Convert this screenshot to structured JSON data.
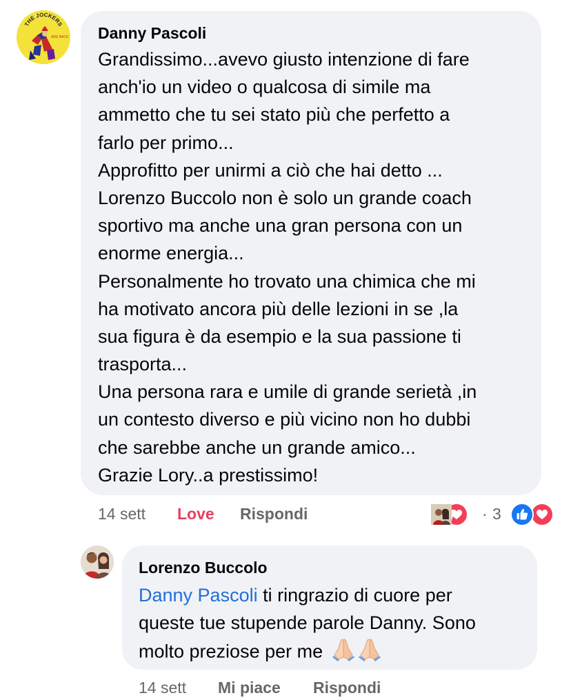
{
  "comment": {
    "author": "Danny Pascoli",
    "lines": [
      "Grandissimo...avevo giusto intenzione di fare",
      "anch'io un video o qualcosa di simile ma",
      "ammetto che tu sei stato più che perfetto a",
      "farlo per primo...",
      "Approfitto per unirmi a ciò che hai detto ...",
      "Lorenzo Buccolo non è solo un grande coach",
      "sportivo ma anche una gran persona con un",
      "enorme energia...",
      "Personalmente ho trovato una chimica che mi",
      "ha motivato ancora più delle lezioni in se ,la",
      "sua figura è da esempio e la sua passione ti",
      "trasporta...",
      "Una persona rara e umile di grande serietà ,in",
      "un contesto diverso e più vicino non ho dubbi",
      "che sarebbe anche un grande amico...",
      "Grazie Lory..a prestissimo!"
    ],
    "avatar_icon": "jockers-logo-avatar",
    "avatar_text_1": "THE JOCKERS",
    "avatar_text_2": "ARE BACK",
    "time": "14 sett",
    "reaction_action": "Love",
    "reply_action": "Rispondi",
    "reaction_summary_count": "3",
    "reaction_separator": "·",
    "reaction_icons": [
      "reactor-photo-avatar",
      "heart-reaction-icon",
      "like-reaction-icon",
      "heart-reaction-icon"
    ],
    "love_color": "#e4405f"
  },
  "reply": {
    "author": "Lorenzo Buccolo",
    "mention": "Danny Pascoli",
    "line1_rest": " ti ringrazio di cuore per",
    "line2": "queste tue stupende parole Danny. Sono",
    "line3": "molto preziose per me",
    "emoji_icons": [
      "folded-hands-icon",
      "folded-hands-icon"
    ],
    "time": "14 sett",
    "like_action": "Mi piace",
    "reply_action": "Rispondi",
    "mention_color": "#216fdb"
  },
  "colors": {
    "bubble": "#f0f2f5",
    "meta": "#65676b",
    "like_blue": "#1877f2",
    "heart_red": "#f33e58"
  }
}
